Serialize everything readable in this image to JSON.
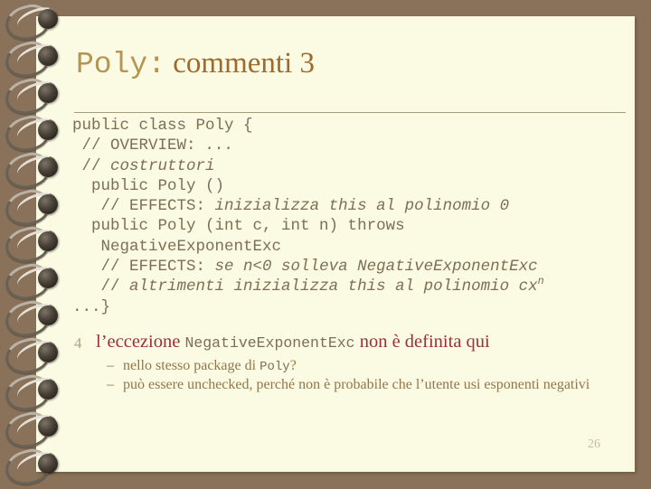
{
  "slide": {
    "colors": {
      "background": "#8a725a",
      "page": "#fbfae3",
      "title_mono": "#b59454",
      "title_serif": "#a06a2c",
      "code_text": "#7d6f55",
      "bullet_level1": "#9e2f3a",
      "bullet_level2": "#93764a",
      "rule": "#ab9b74",
      "page_number": "#c3bc9a"
    },
    "title": {
      "mono_part": "Poly:",
      "serif_part": " commenti 3"
    },
    "code_lines": [
      {
        "indent": "",
        "segments": [
          {
            "text": "public class Poly {",
            "style": "plain"
          }
        ]
      },
      {
        "indent": " ",
        "segments": [
          {
            "text": "// OVERVIEW: ",
            "style": "plain"
          },
          {
            "text": "...",
            "style": "italic"
          }
        ]
      },
      {
        "indent": " ",
        "segments": [
          {
            "text": "// ",
            "style": "plain"
          },
          {
            "text": "costruttori",
            "style": "italic"
          }
        ]
      },
      {
        "indent": "  ",
        "segments": [
          {
            "text": "public Poly ()",
            "style": "plain"
          }
        ]
      },
      {
        "indent": "   ",
        "segments": [
          {
            "text": "// EFFECTS: ",
            "style": "plain"
          },
          {
            "text": "inizializza this al polinomio 0",
            "style": "italic"
          }
        ]
      },
      {
        "indent": "  ",
        "segments": [
          {
            "text": "public Poly (int c, int n) throws",
            "style": "plain"
          }
        ]
      },
      {
        "indent": "   ",
        "segments": [
          {
            "text": "NegativeExponentExc",
            "style": "plain"
          }
        ]
      },
      {
        "indent": "   ",
        "segments": [
          {
            "text": "// EFFECTS: ",
            "style": "plain"
          },
          {
            "text": "se n<0 solleva NegativeExponentExc",
            "style": "italic"
          }
        ]
      },
      {
        "indent": "   ",
        "segments": [
          {
            "text": "// ",
            "style": "plain"
          },
          {
            "text": "altrimenti inizializza this al polinomio cx",
            "style": "italic"
          },
          {
            "text": "n",
            "style": "superscript"
          }
        ]
      },
      {
        "indent": "",
        "segments": [
          {
            "text": "...}",
            "style": "plain"
          }
        ]
      }
    ],
    "bullets": {
      "main": {
        "marker": "4",
        "segments": [
          {
            "text": "l’eccezione ",
            "style": "serif"
          },
          {
            "text": "NegativeExponentExc",
            "style": "mono"
          },
          {
            "text": " non è definita qui",
            "style": "serif"
          }
        ]
      },
      "sub": [
        {
          "marker": "–",
          "segments": [
            {
              "text": "nello stesso package di ",
              "style": "serif"
            },
            {
              "text": "Poly",
              "style": "mono"
            },
            {
              "text": "?",
              "style": "serif"
            }
          ]
        },
        {
          "marker": "–",
          "segments": [
            {
              "text": "può essere unchecked, perché non è probabile che l’utente usi esponenti negativi",
              "style": "serif"
            }
          ]
        }
      ]
    },
    "page_number": "26"
  }
}
